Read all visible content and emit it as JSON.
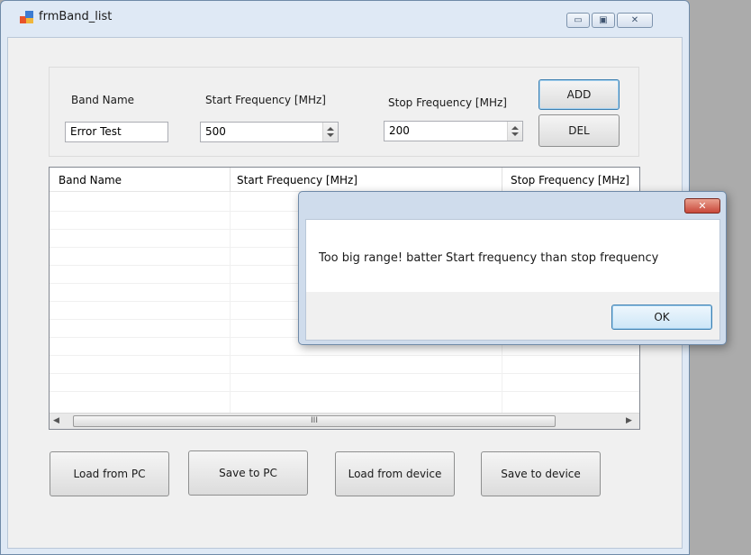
{
  "window": {
    "title": "frmBand_list",
    "controls": {
      "minimize": "▭",
      "maximize": "▣",
      "close": "✕"
    }
  },
  "form": {
    "band_name_label": "Band Name",
    "band_name_value": "Error Test",
    "start_freq_label": "Start Frequency [MHz]",
    "start_freq_value": "500",
    "stop_freq_label": "Stop Frequency [MHz]",
    "stop_freq_value": "200",
    "add_label": "ADD",
    "del_label": "DEL"
  },
  "table": {
    "columns": [
      "Band Name",
      "Start Frequency [MHz]",
      "Stop Frequency [MHz]"
    ],
    "rows": [],
    "scroll_left": "◀",
    "scroll_right": "▶",
    "scroll_thumb_grip": "III"
  },
  "buttons": {
    "load_pc": "Load from PC",
    "save_pc": "Save to PC",
    "load_device": "Load from device",
    "save_device": "Save to device"
  },
  "dialog": {
    "message": "Too big range! batter Start frequency than stop frequency",
    "ok_label": "OK",
    "close_glyph": "✕"
  },
  "colors": {
    "window_frame": "#dfe9f5",
    "client": "#f0f0f0",
    "dialog_close": "#c9483a",
    "ok_border": "#3c7fb1"
  }
}
